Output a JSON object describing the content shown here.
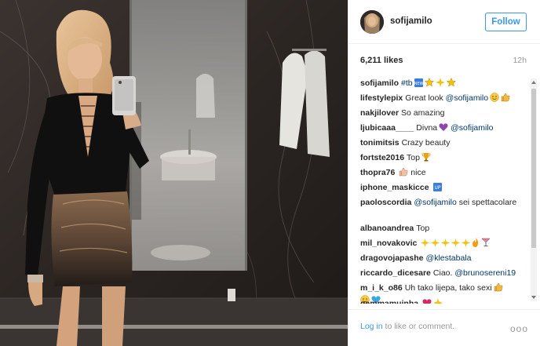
{
  "post": {
    "photo_description_icon": "mirror-selfie-photo"
  },
  "header": {
    "username": "sofijamilo",
    "follow_label": "Follow"
  },
  "stats": {
    "likes": "6,211 likes",
    "time": "12h"
  },
  "comments": [
    {
      "user": "sofijamilo",
      "text": "#tb",
      "emoji": [
        "new-icon",
        "star",
        "sparkle",
        "star"
      ]
    },
    {
      "user": "lifestylepix",
      "text": "Great look",
      "mention": "@sofijamilo",
      "emoji": [
        "smile",
        "thumbs-up"
      ]
    },
    {
      "user": "nakjilover",
      "text": "So amazing",
      "emoji": []
    },
    {
      "user": "ljubicaaa____",
      "text": "Divna",
      "mention": "@sofijamilo",
      "emoji_before_mention": [
        "purple-heart"
      ]
    },
    {
      "user": "tonimitsis",
      "text": "Crazy beauty",
      "emoji": []
    },
    {
      "user": "fortste2016",
      "text": "Top",
      "emoji": [
        "trophy"
      ]
    },
    {
      "user": "thopra76",
      "text": "nice",
      "emoji_before_text": [
        "thumbs-up"
      ]
    },
    {
      "user": "iphone_maskicce",
      "text": "",
      "emoji": [
        "up-icon"
      ]
    },
    {
      "user": "paoloscordia",
      "mention": "@sofijamilo",
      "text": "sei spettacolare"
    },
    {
      "user": "albanoandrea",
      "text": "Top"
    },
    {
      "user": "mil_novakovic",
      "text": "",
      "emoji": [
        "sparkle",
        "sparkle",
        "sparkle",
        "sparkle",
        "sparkle",
        "fire",
        "cocktail"
      ]
    },
    {
      "user": "dragovojapashe",
      "mention": "@klestabala",
      "text": ""
    },
    {
      "user": "riccardo_dicesare",
      "text": "Ciao.",
      "mention": "@brunosereni19"
    },
    {
      "user": "m_i_k_o86",
      "text": "Uh tako lijepa, tako sexi",
      "emoji": [
        "thumbs-up",
        "smile",
        "blue-heart"
      ]
    },
    {
      "user": "gemmamuinha",
      "text": "",
      "emoji": [
        "heart",
        "sparkle"
      ]
    }
  ],
  "footer": {
    "login_label": "Log in",
    "suffix": "to like or comment.",
    "more_label": "ooo"
  },
  "colors": {
    "accent": "#3897f0",
    "mention": "#003569",
    "muted": "#999999",
    "text": "#262626"
  }
}
